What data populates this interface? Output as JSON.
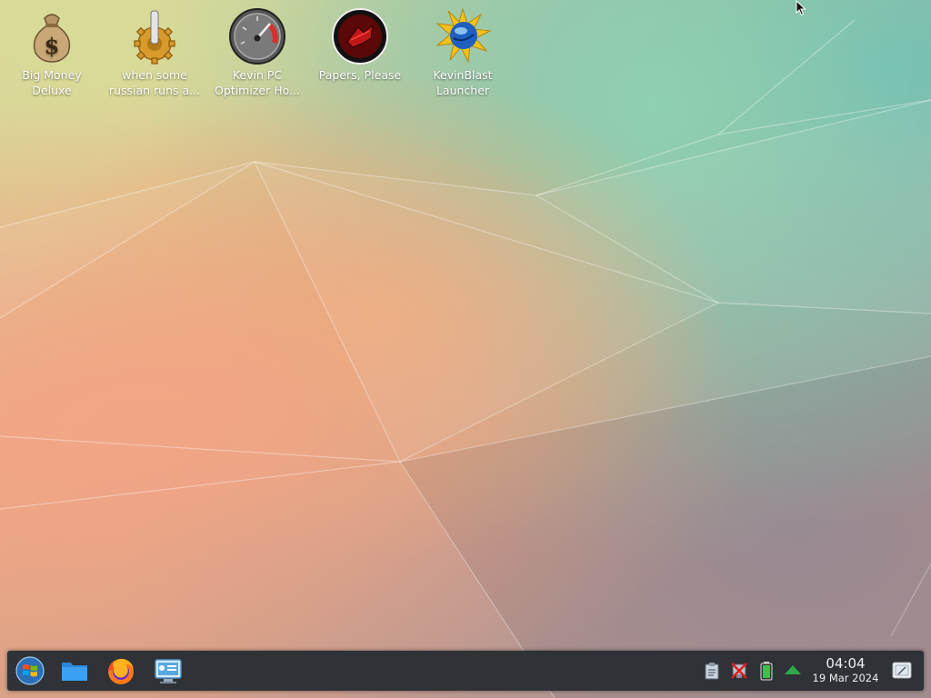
{
  "desktop": {
    "icons": [
      {
        "label": "Big Money\nDeluxe",
        "icon": "money-bag-icon"
      },
      {
        "label": "when some\nrussian runs a...",
        "icon": "gear-lever-icon"
      },
      {
        "label": "Kevin PC\nOptimizer Ho...",
        "icon": "speedometer-icon"
      },
      {
        "label": "Papers, Please",
        "icon": "papers-please-emblem-icon"
      },
      {
        "label": "KevinBlast\nLauncher",
        "icon": "globe-burst-icon"
      }
    ]
  },
  "taskbar": {
    "launchers": [
      {
        "name": "start-menu-button",
        "icon": "windows-orb-icon"
      },
      {
        "name": "file-manager-button",
        "icon": "folder-icon"
      },
      {
        "name": "firefox-button",
        "icon": "firefox-icon"
      },
      {
        "name": "control-panel-button",
        "icon": "control-panel-icon"
      }
    ],
    "tray": [
      {
        "name": "clipboard-icon"
      },
      {
        "name": "network-disconnected-icon"
      },
      {
        "name": "battery-icon"
      },
      {
        "name": "updates-arrow-icon"
      }
    ],
    "clock": {
      "time": "04:04",
      "date": "19 Mar 2024"
    },
    "show_desktop_icon": "show-desktop-icon"
  },
  "colors": {
    "taskbar_bg": "#2f3236",
    "label_text": "#ffffff",
    "clock_text": "#eeeeee"
  }
}
